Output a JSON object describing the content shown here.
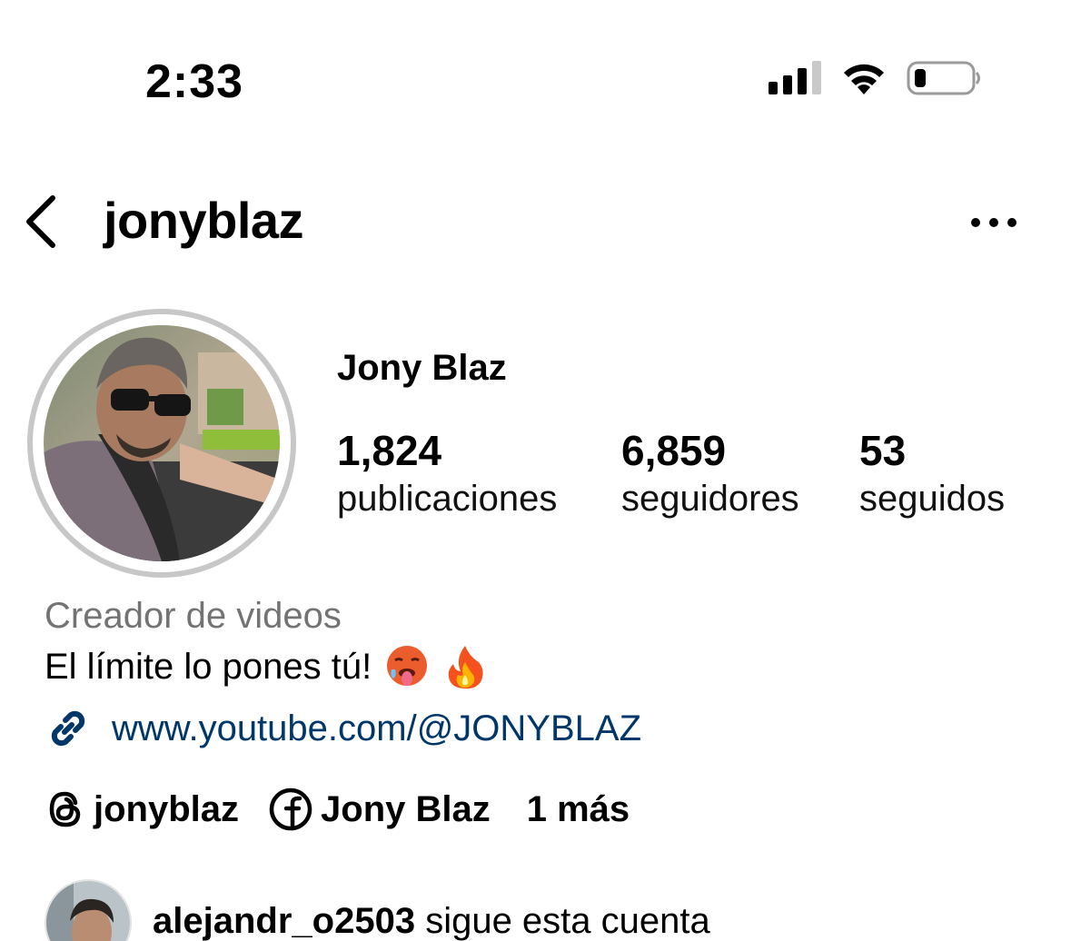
{
  "status_bar": {
    "time": "2:33",
    "icons": [
      "cellular-signal-icon",
      "wifi-icon",
      "battery-icon"
    ]
  },
  "header": {
    "username": "jonyblaz",
    "back_icon": "chevron-left-icon",
    "more_icon": "ellipsis-icon"
  },
  "profile": {
    "display_name": "Jony Blaz",
    "stats": [
      {
        "value": "1,824",
        "label": "publicaciones"
      },
      {
        "value": "6,859",
        "label": "seguidores"
      },
      {
        "value": "53",
        "label": "seguidos"
      }
    ],
    "category": "Creador de videos",
    "bio": "El límite lo pones tú!",
    "bio_emojis": [
      "hot-face-emoji",
      "fire-emoji"
    ],
    "link": "www.youtube.com/@JONYBLAZ",
    "socials": [
      {
        "icon": "threads-icon",
        "label": "jonyblaz"
      },
      {
        "icon": "facebook-icon",
        "label": "Jony Blaz"
      },
      {
        "icon": "",
        "label": "1 más"
      }
    ],
    "followed_by": {
      "username": "alejandr_o2503",
      "suffix": "sigue esta cuenta"
    }
  },
  "colors": {
    "link": "#00376b",
    "category": "#737373",
    "avatar_ring": "#c7c7c7"
  }
}
